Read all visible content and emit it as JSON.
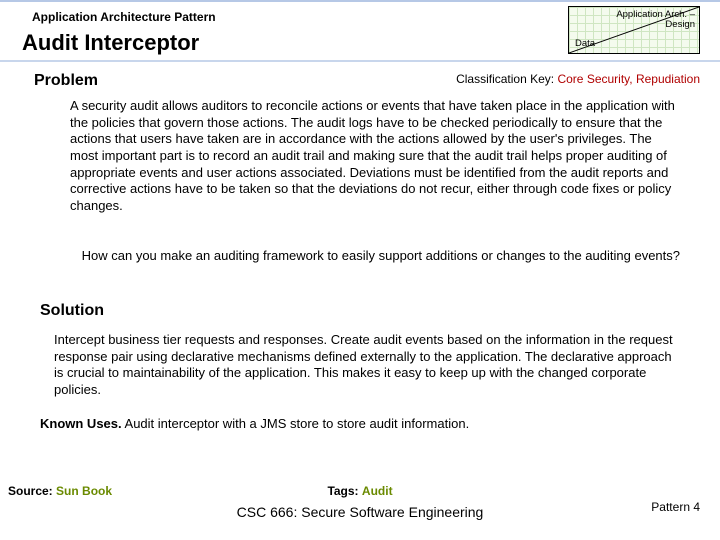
{
  "eyebrow": "Application Architecture Pattern",
  "title": "Audit Interceptor",
  "badge": {
    "top_right_line1": "Application Arch. –",
    "top_right_line2": "Design",
    "bottom_left": "Data"
  },
  "classification": {
    "label": "Classification Key:",
    "value": "Core Security, Repudiation"
  },
  "sections": {
    "problem": "Problem",
    "solution": "Solution"
  },
  "problem_body": "A security audit allows auditors to reconcile actions or events that have taken place in the application with the policies that govern those actions. The audit logs have to be checked periodically to ensure that the actions that users have taken are in accordance with the actions allowed by the user's privileges. The most important part is to record an audit trail and making sure that the audit trail helps proper auditing of appropriate events and user actions associated. Deviations must be identified from the audit reports and corrective actions have to be taken so that the deviations do not recur, either through code fixes or policy changes.",
  "problem_question": "How can you make an auditing framework to easily support additions or changes to the auditing events?",
  "solution_body": "Intercept business tier requests and responses. Create audit events based on the information in the request response pair using declarative mechanisms defined externally to the application. The declarative approach is crucial to maintainability of the application. This makes it easy to keep up with the changed corporate policies.",
  "known_uses": {
    "label": "Known Uses.",
    "text": "Audit interceptor with a JMS store to store audit information."
  },
  "source": {
    "label": "Source:",
    "value": "Sun Book"
  },
  "tags": {
    "label": "Tags:",
    "value": "Audit"
  },
  "course": "CSC 666: Secure Software Engineering",
  "pattern": "Pattern 4"
}
